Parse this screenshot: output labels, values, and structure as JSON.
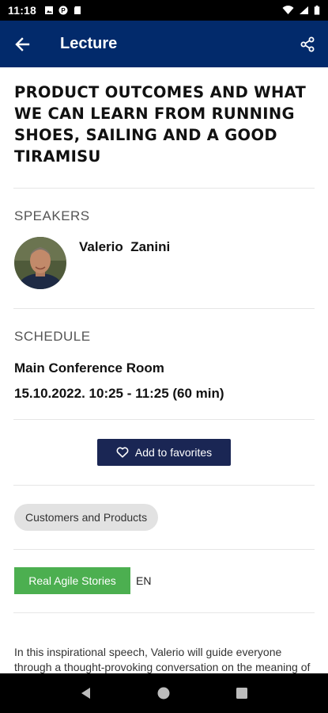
{
  "status_bar": {
    "time": "11:18",
    "icons_left": [
      "photo-notification-icon",
      "app-notification-icon",
      "sd-card-icon"
    ],
    "icons_right": [
      "wifi-icon",
      "signal-icon",
      "battery-icon"
    ]
  },
  "app_bar": {
    "title": "Lecture",
    "back_icon": "arrow-back-icon",
    "share_icon": "share-icon",
    "background": "#022a6b"
  },
  "lecture": {
    "title": "PRODUCT OUTCOMES AND WHAT WE CAN LEARN FROM RUNNING SHOES, SAILING AND A GOOD TIRAMISU"
  },
  "speakers": {
    "label": "SPEAKERS",
    "items": [
      {
        "name": "Valerio  Zanini",
        "avatar": "speaker-photo"
      }
    ]
  },
  "schedule": {
    "label": "SCHEDULE",
    "room": "Main Conference Room",
    "time": "15.10.2022. 10:25 - 11:25 (60 min)"
  },
  "favorites": {
    "label": "Add to favorites",
    "icon": "heart-outline-icon",
    "color": "#1a2654"
  },
  "category": {
    "label": "Customers and Products"
  },
  "track": {
    "label": "Real Agile Stories",
    "color": "#4caf50",
    "language": "EN"
  },
  "description": {
    "text": "In this inspirational speech, Valerio will guide everyone through a thought-provoking conversation on the meaning of product outcomes"
  },
  "nav_bar": {
    "icons": [
      "back-triangle-icon",
      "home-circle-icon",
      "recents-square-icon"
    ]
  }
}
